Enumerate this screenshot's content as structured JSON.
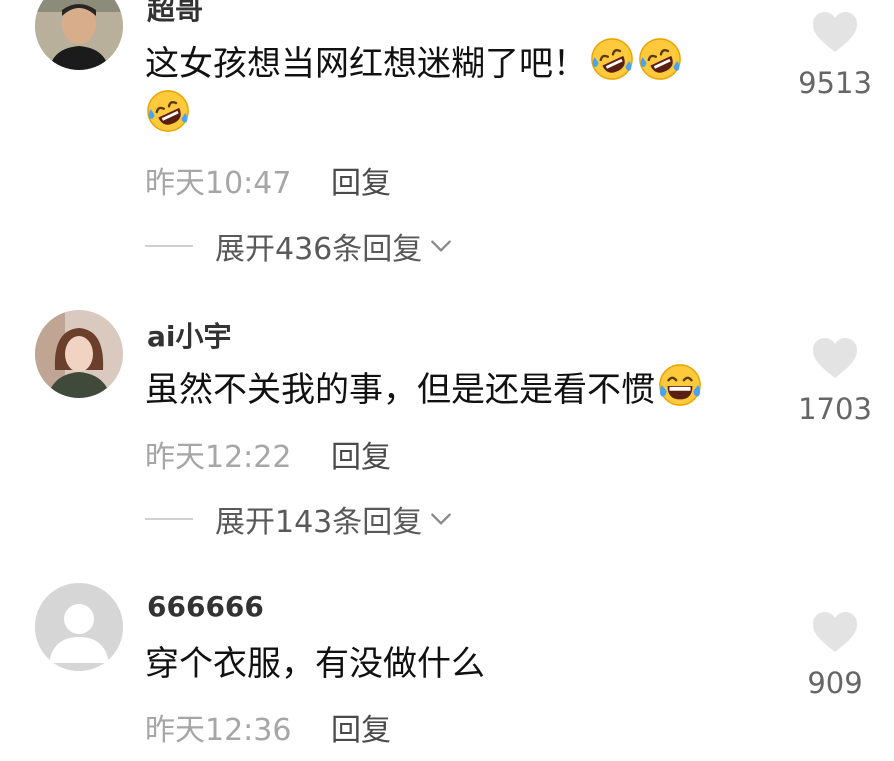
{
  "comments": [
    {
      "username": "超哥",
      "text_line1": "这女孩想当网红想迷糊了吧！",
      "time": "昨天10:47",
      "reply_label": "回复",
      "expand_label": "展开436条回复",
      "likes": "9513"
    },
    {
      "username": "ai小宇",
      "text_line1": "虽然不关我的事，但是还是看不惯",
      "time": "昨天12:22",
      "reply_label": "回复",
      "expand_label": "展开143条回复",
      "likes": "1703"
    },
    {
      "username": "666666",
      "text_line1": "穿个衣服，有没做什么",
      "time": "昨天12:36",
      "reply_label": "回复",
      "likes": "909"
    }
  ],
  "icons": {
    "like": "heart-icon",
    "expand": "chevron-down-icon",
    "emoji": "rolling-on-floor-laughing-emoji",
    "emoji_joy": "tears-of-joy-emoji"
  },
  "colors": {
    "heart": "#e3e3e3",
    "time": "#a6a6a6",
    "reply": "#4a4a4a",
    "emoji_yellow": "#ffc93c",
    "emoji_tears": "#4aa3f0"
  }
}
